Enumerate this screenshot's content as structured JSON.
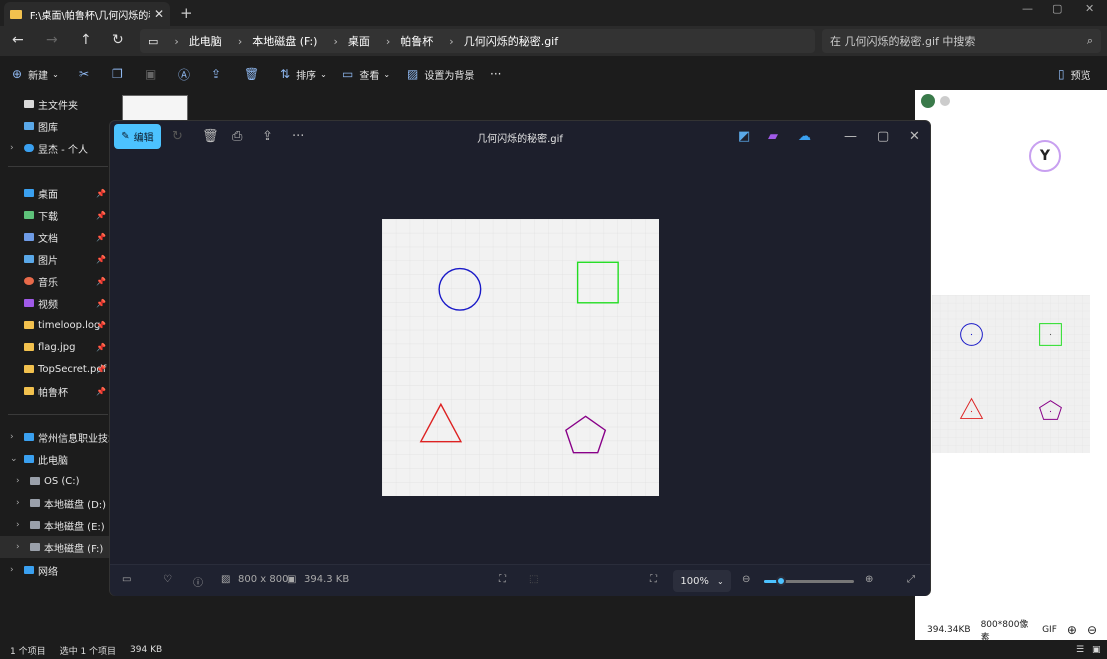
{
  "tab": {
    "title": "F:\\桌面\\帕鲁杯\\几何闪烁的秘密",
    "close": "✕",
    "new": "+"
  },
  "window_controls": {
    "minimize": "—",
    "maximize": "▢",
    "close": "✕"
  },
  "breadcrumb": [
    "此电脑",
    "本地磁盘 (F:)",
    "桌面",
    "帕鲁杯",
    "几何闪烁的秘密.gif"
  ],
  "breadcrumb_sep": "›",
  "search": {
    "placeholder": "在 几何闪烁的秘密.gif 中搜索"
  },
  "toolbar": {
    "new": "新建",
    "sort": "排序",
    "view": "查看",
    "set_background": "设置为背景",
    "more": "···",
    "preview": "预览"
  },
  "sidebar": {
    "top": [
      {
        "label": "主文件夹",
        "icon": "home-icon"
      },
      {
        "label": "图库",
        "icon": "gallery-icon"
      },
      {
        "label": "昱杰 - 个人",
        "icon": "cloud-icon"
      }
    ],
    "quick": [
      {
        "label": "桌面",
        "color": "#3aa0f0"
      },
      {
        "label": "下载",
        "color": "#5ec27a"
      },
      {
        "label": "文档",
        "color": "#6e9be6"
      },
      {
        "label": "图片",
        "color": "#5aa8e8"
      },
      {
        "label": "音乐",
        "color": "#e86a4a"
      },
      {
        "label": "视频",
        "color": "#a05ae8"
      },
      {
        "label": "timeloop.log",
        "color": "#f2c14e"
      },
      {
        "label": "flag.jpg",
        "color": "#f2c14e"
      },
      {
        "label": "TopSecret.pdf",
        "color": "#f2c14e"
      },
      {
        "label": "帕鲁杯",
        "color": "#f2c14e"
      }
    ],
    "tree": [
      {
        "label": "常州信息职业技术学"
      },
      {
        "label": "此电脑"
      },
      {
        "label": "OS (C:)"
      },
      {
        "label": "本地磁盘 (D:)"
      },
      {
        "label": "本地磁盘 (E:)"
      },
      {
        "label": "本地磁盘 (F:)"
      },
      {
        "label": "网络"
      }
    ]
  },
  "viewer": {
    "edit": "编辑",
    "title": "几何闪烁的秘密.gif",
    "dimensions": "800 x 800",
    "size": "394.3 KB",
    "zoom": "100%",
    "zoom_level": 0.18
  },
  "shapes": {
    "circle_color": "#1a1ac8",
    "square_color": "#22dd22",
    "triangle_color": "#dd2222",
    "pentagon_color": "#880088"
  },
  "preview_pane": {
    "size": "394.34KB",
    "dimensions": "800*800像素",
    "format": "GIF"
  },
  "status": {
    "items": "1 个项目",
    "selected": "选中 1 个项目",
    "size": "394 KB"
  }
}
